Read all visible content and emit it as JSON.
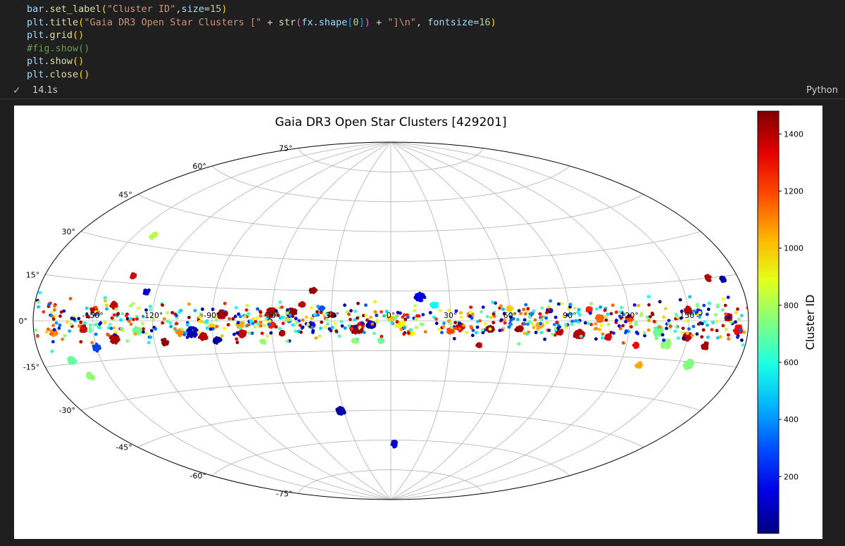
{
  "notebook": {
    "code_lines": [
      [
        [
          "t-var",
          "bar"
        ],
        [
          "t-punc",
          "."
        ],
        [
          "t-fn",
          "set_label"
        ],
        [
          "t-br1",
          "("
        ],
        [
          "t-str",
          "\"Cluster ID\""
        ],
        [
          "t-punc",
          ","
        ],
        [
          "t-var",
          "size"
        ],
        [
          "t-punc",
          "="
        ],
        [
          "t-num",
          "15"
        ],
        [
          "t-br1",
          ")"
        ]
      ],
      [
        [
          "t-var",
          "plt"
        ],
        [
          "t-punc",
          "."
        ],
        [
          "t-fn",
          "title"
        ],
        [
          "t-br1",
          "("
        ],
        [
          "t-str",
          "\"Gaia DR3 Open Star Clusters [\""
        ],
        [
          "t-punc",
          " + "
        ],
        [
          "t-fn",
          "str"
        ],
        [
          "t-br2",
          "("
        ],
        [
          "t-var",
          "fx"
        ],
        [
          "t-punc",
          "."
        ],
        [
          "t-var",
          "shape"
        ],
        [
          "t-br3",
          "["
        ],
        [
          "t-num",
          "0"
        ],
        [
          "t-br3",
          "]"
        ],
        [
          "t-br2",
          ")"
        ],
        [
          "t-punc",
          " + "
        ],
        [
          "t-str",
          "\"]\\n\""
        ],
        [
          "t-punc",
          ", "
        ],
        [
          "t-var",
          "fontsize"
        ],
        [
          "t-punc",
          "="
        ],
        [
          "t-num",
          "16"
        ],
        [
          "t-br1",
          ")"
        ]
      ],
      [
        [
          "t-var",
          "plt"
        ],
        [
          "t-punc",
          "."
        ],
        [
          "t-fn",
          "grid"
        ],
        [
          "t-br1",
          "()"
        ]
      ],
      [
        [
          "t-cmt",
          "#fig.show()"
        ]
      ],
      [
        [
          "t-var",
          "plt"
        ],
        [
          "t-punc",
          "."
        ],
        [
          "t-fn",
          "show"
        ],
        [
          "t-br1",
          "()"
        ]
      ],
      [
        [
          "t-var",
          "plt"
        ],
        [
          "t-punc",
          "."
        ],
        [
          "t-fn",
          "close"
        ],
        [
          "t-br1",
          "()"
        ]
      ]
    ],
    "status": {
      "check_icon": "✓",
      "time": "14.1s",
      "language": "Python"
    }
  },
  "chart_data": {
    "type": "scatter",
    "projection": "aitoff",
    "title": "Gaia DR3 Open Star Clusters [429201]",
    "grid": true,
    "lon_ticks": [
      -150,
      -120,
      -90,
      -60,
      -30,
      0,
      30,
      60,
      90,
      120,
      150
    ],
    "lon_tick_labels": [
      "-150°",
      "-120°",
      "-90°",
      "-60°",
      "-30°",
      "0°",
      "30°",
      "60°",
      "90°",
      "120°",
      "150°"
    ],
    "lat_ticks": [
      -75,
      -60,
      -45,
      -30,
      -15,
      0,
      15,
      30,
      45,
      60,
      75
    ],
    "lat_tick_labels": [
      "-75°",
      "-60°",
      "-45°",
      "-30°",
      "-15°",
      "0°",
      "15°",
      "30°",
      "45°",
      "60°",
      "75°"
    ],
    "colorbar": {
      "label": "Cluster ID",
      "colormap": "jet",
      "range": [
        1,
        1480
      ],
      "ticks": [
        200,
        400,
        600,
        800,
        1000,
        1200,
        1400
      ],
      "tick_labels": [
        "200",
        "400",
        "600",
        "800",
        "1000",
        "1200",
        "1400"
      ]
    },
    "clusters": [
      {
        "lon": -17,
        "lat": -4,
        "id": 1450,
        "r": 2.0
      },
      {
        "lon": -50,
        "lat": 4,
        "id": 1460,
        "r": 1.6
      },
      {
        "lon": -60,
        "lat": 4,
        "id": 1400,
        "r": 1.6
      },
      {
        "lon": -85,
        "lat": 3,
        "id": 1420,
        "r": 1.5
      },
      {
        "lon": -40,
        "lat": 15,
        "id": 1440,
        "r": 1.0
      },
      {
        "lon": 5,
        "lat": -2,
        "id": 940,
        "r": 1.6
      },
      {
        "lon": -100,
        "lat": -5,
        "id": 80,
        "r": 1.8
      },
      {
        "lon": -106,
        "lat": -5,
        "id": 1100,
        "r": 1.3
      },
      {
        "lon": -95,
        "lat": -7,
        "id": 1400,
        "r": 1.3
      },
      {
        "lon": -88,
        "lat": -9,
        "id": 40,
        "r": 1.2
      },
      {
        "lon": -75,
        "lat": -6,
        "id": 1380,
        "r": 1.3
      },
      {
        "lon": -140,
        "lat": -7,
        "id": 1420,
        "r": 1.4
      },
      {
        "lon": -150,
        "lat": -10,
        "id": 280,
        "r": 1.1
      },
      {
        "lon": -155,
        "lat": -3,
        "id": 1320,
        "r": 1.0
      },
      {
        "lon": -165,
        "lat": -14,
        "id": 700,
        "r": 1.1
      },
      {
        "lon": -160,
        "lat": -20,
        "id": 760,
        "r": 1.0
      },
      {
        "lon": -128,
        "lat": -4,
        "id": 720,
        "r": 1.2
      },
      {
        "lon": -150,
        "lat": 4,
        "id": 1400,
        "r": 1.0
      },
      {
        "lon": -140,
        "lat": 6,
        "id": 1380,
        "r": 1.0
      },
      {
        "lon": -125,
        "lat": 12,
        "id": 120,
        "r": 0.9
      },
      {
        "lon": -135,
        "lat": 18,
        "id": 1350,
        "r": 0.8
      },
      {
        "lon": -140,
        "lat": 34,
        "id": 820,
        "r": 1.0
      },
      {
        "lon": -90,
        "lat": -3,
        "id": 1000,
        "r": 1.0
      },
      {
        "lon": -76,
        "lat": -2,
        "id": 1050,
        "r": 1.0
      },
      {
        "lon": -60,
        "lat": -2,
        "id": 1250,
        "r": 1.0
      },
      {
        "lon": -40,
        "lat": -2,
        "id": 1300,
        "r": 1.0
      },
      {
        "lon": -30,
        "lat": 3,
        "id": 1440,
        "r": 1.0
      },
      {
        "lon": -10,
        "lat": -2,
        "id": 40,
        "r": 1.3
      },
      {
        "lon": -18,
        "lat": -10,
        "id": 760,
        "r": 0.9
      },
      {
        "lon": -15,
        "lat": -2,
        "id": 1320,
        "r": 0.9
      },
      {
        "lon": 0,
        "lat": 1,
        "id": 1020,
        "r": 1.0
      },
      {
        "lon": 15,
        "lat": 12,
        "id": 140,
        "r": 1.6
      },
      {
        "lon": 22,
        "lat": 8,
        "id": 560,
        "r": 1.0
      },
      {
        "lon": 35,
        "lat": -3,
        "id": 1380,
        "r": 1.2
      },
      {
        "lon": 30,
        "lat": -5,
        "id": 1200,
        "r": 1.0
      },
      {
        "lon": 50,
        "lat": -4,
        "id": 1450,
        "r": 1.1
      },
      {
        "lon": 65,
        "lat": -4,
        "id": 1430,
        "r": 1.0
      },
      {
        "lon": 75,
        "lat": -2,
        "id": 1050,
        "r": 1.0
      },
      {
        "lon": 85,
        "lat": -5,
        "id": 1400,
        "r": 1.0
      },
      {
        "lon": 95,
        "lat": -6,
        "id": 1400,
        "r": 1.6
      },
      {
        "lon": 105,
        "lat": 1,
        "id": 1150,
        "r": 1.2
      },
      {
        "lon": 120,
        "lat": 1,
        "id": 1200,
        "r": 1.0
      },
      {
        "lon": 135,
        "lat": -4,
        "id": 720,
        "r": 1.7
      },
      {
        "lon": 140,
        "lat": -9,
        "id": 760,
        "r": 1.4
      },
      {
        "lon": 150,
        "lat": -6,
        "id": 1400,
        "r": 1.3
      },
      {
        "lon": 155,
        "lat": -16,
        "id": 740,
        "r": 1.4
      },
      {
        "lon": 160,
        "lat": -9,
        "id": 1420,
        "r": 1.0
      },
      {
        "lon": 170,
        "lat": 1,
        "id": 1420,
        "r": 1.0
      },
      {
        "lon": 165,
        "lat": 15,
        "id": 1400,
        "r": 0.8
      },
      {
        "lon": 172,
        "lat": 14,
        "id": 50,
        "r": 0.7
      },
      {
        "lon": 175,
        "lat": -3,
        "id": 1300,
        "r": 1.2
      },
      {
        "lon": 150,
        "lat": 4,
        "id": 1380,
        "r": 1.0
      },
      {
        "lon": 155,
        "lat": 3,
        "id": 240,
        "r": 0.9
      },
      {
        "lon": 130,
        "lat": -18,
        "id": 1050,
        "r": 0.9
      },
      {
        "lon": 45,
        "lat": -12,
        "id": 1400,
        "r": 0.7
      },
      {
        "lon": -32,
        "lat": -45,
        "id": 60,
        "r": 1.6
      },
      {
        "lon": 3,
        "lat": -62,
        "id": 120,
        "r": 1.3
      },
      {
        "lon": -40,
        "lat": -2,
        "id": 80,
        "r": 0.8
      },
      {
        "lon": -35,
        "lat": 6,
        "id": 300,
        "r": 0.8
      },
      {
        "lon": 40,
        "lat": 3,
        "id": 1100,
        "r": 0.9
      },
      {
        "lon": 60,
        "lat": 6,
        "id": 1000,
        "r": 0.8
      },
      {
        "lon": 80,
        "lat": 5,
        "id": 120,
        "r": 0.8
      },
      {
        "lon": 100,
        "lat": 5,
        "id": 1250,
        "r": 0.8
      },
      {
        "lon": 110,
        "lat": -7,
        "id": 1350,
        "r": 0.9
      },
      {
        "lon": 125,
        "lat": -10,
        "id": 1300,
        "r": 0.8
      },
      {
        "lon": -115,
        "lat": -9,
        "id": 1450,
        "r": 1.1
      },
      {
        "lon": -170,
        "lat": -4,
        "id": 1100,
        "r": 0.9
      },
      {
        "lon": -65,
        "lat": -10,
        "id": 780,
        "r": 0.8
      },
      {
        "lon": -55,
        "lat": -6,
        "id": 1420,
        "r": 0.8
      },
      {
        "lon": -45,
        "lat": 8,
        "id": 1380,
        "r": 0.8
      },
      {
        "lon": 10,
        "lat": -6,
        "id": 940,
        "r": 1.1
      },
      {
        "lon": -5,
        "lat": -10,
        "id": 720,
        "r": 0.8
      }
    ]
  }
}
